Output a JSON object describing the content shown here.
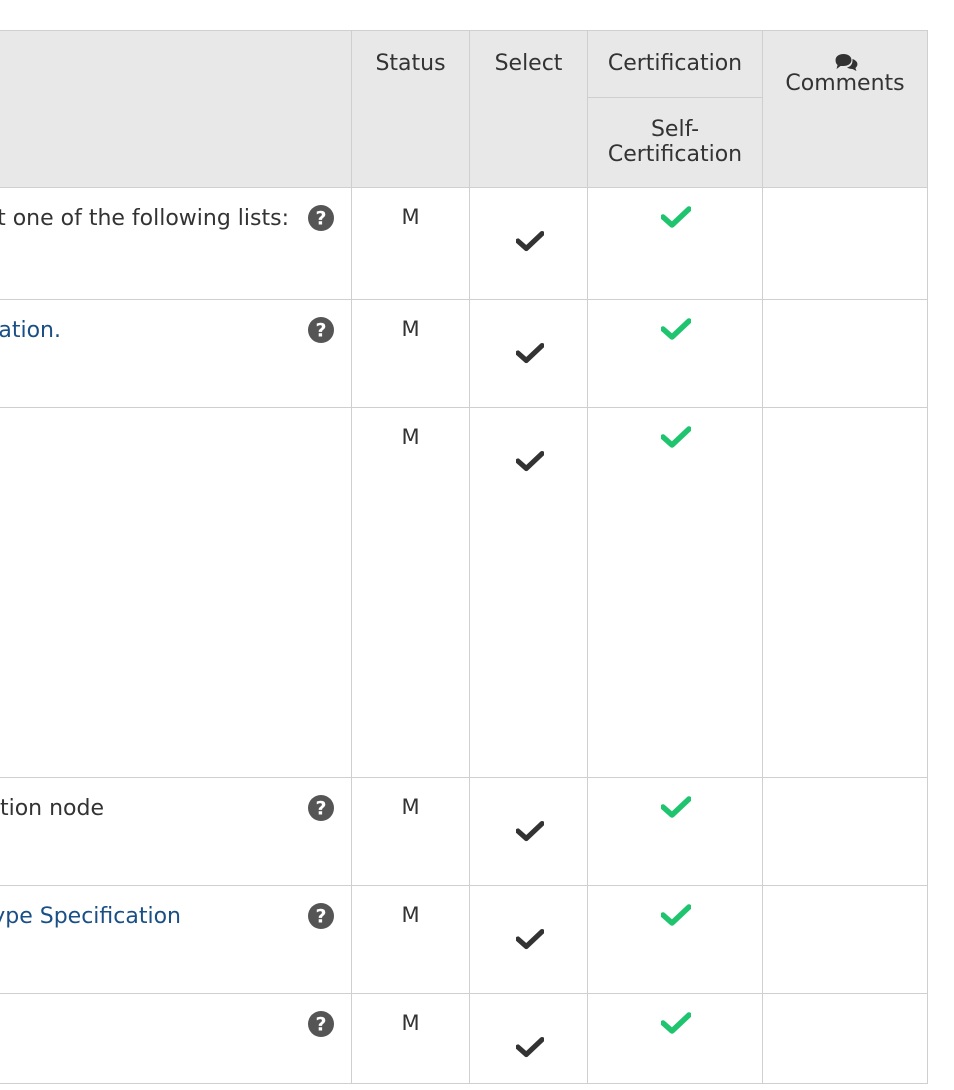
{
  "headers": {
    "status": "Status",
    "select": "Select",
    "certification": "Certification",
    "self_cert_line1": "Self-",
    "self_cert_line2": "Certification",
    "comments": "Comments"
  },
  "colors": {
    "header_bg": "#e8e8e8",
    "border": "#cfcfcf",
    "link": "#1a4f86",
    "select_check": "#333333",
    "cert_check": "#1fc46e",
    "help_icon": "#555555"
  },
  "rows": [
    {
      "description": "ast one of the following lists:",
      "is_link": false,
      "has_help": true,
      "status": "M",
      "selected": true,
      "certified": true
    },
    {
      "description": "cation.",
      "is_link": true,
      "has_help": true,
      "status": "M",
      "selected": true,
      "certified": true
    },
    {
      "description": "",
      "is_link": false,
      "has_help": false,
      "status": "M",
      "selected": true,
      "certified": true
    },
    {
      "description": "ation node",
      "is_link": false,
      "has_help": true,
      "status": "M",
      "selected": true,
      "certified": true
    },
    {
      "description": "Type Specification",
      "is_link": true,
      "has_help": true,
      "status": "M",
      "selected": true,
      "certified": true
    },
    {
      "description": "",
      "is_link": false,
      "has_help": true,
      "status": "M",
      "selected": true,
      "certified": true
    }
  ],
  "icons": {
    "help": "question-circle-icon",
    "select_check": "check-icon",
    "cert_check": "check-icon",
    "comments": "comments-icon"
  }
}
